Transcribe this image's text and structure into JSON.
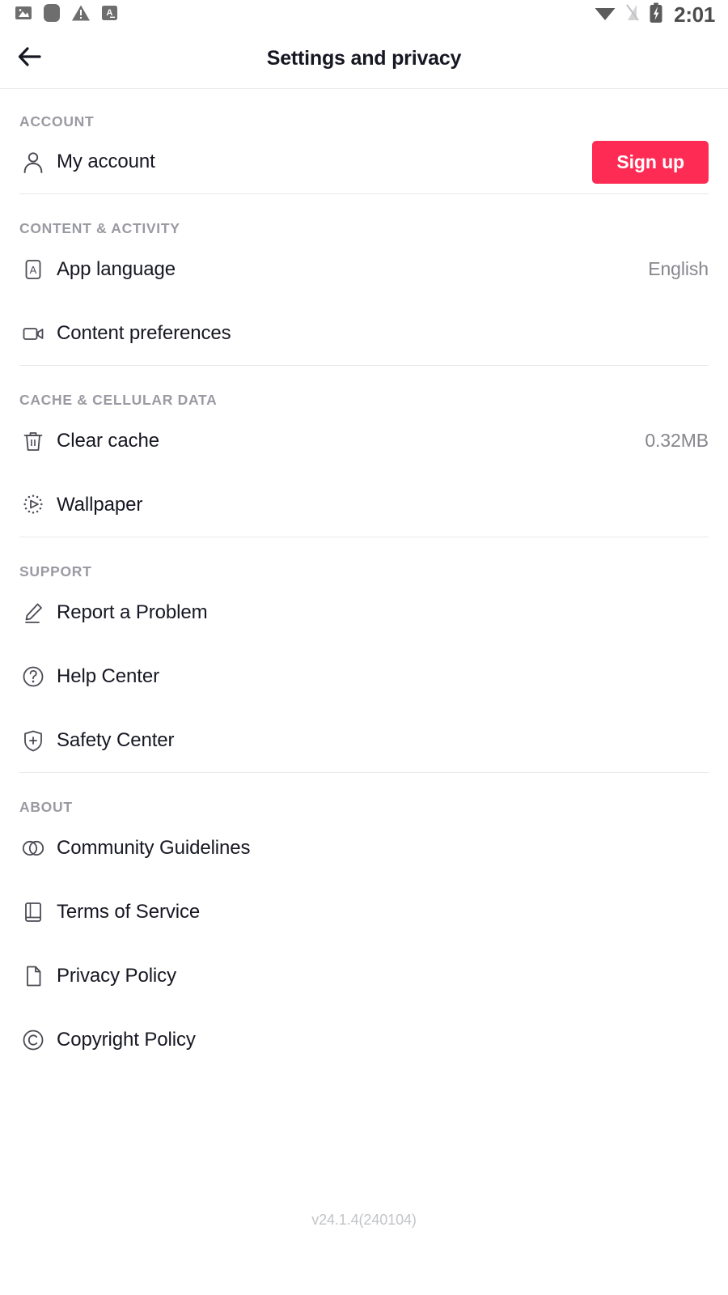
{
  "statusbar": {
    "left_icons": [
      "photo-icon",
      "rounded-square-icon",
      "warning-triangle-icon",
      "keyboard-language-icon"
    ],
    "right_icons": [
      "wifi-icon",
      "signal-off-icon",
      "battery-charging-icon"
    ],
    "time": "2:01"
  },
  "header": {
    "back_icon": "arrow-left-icon",
    "title": "Settings and privacy"
  },
  "colors": {
    "accent": "#fe2c55",
    "text_primary": "#161722",
    "text_secondary": "#86868d",
    "section_header": "#9a9aa2",
    "divider": "#e8e9eb",
    "version_text": "#c3c4c8"
  },
  "sections": [
    {
      "key": "account",
      "title": "ACCOUNT",
      "rows": [
        {
          "icon": "person-icon",
          "label": "My account",
          "value": "",
          "button": "Sign up"
        }
      ]
    },
    {
      "key": "content_activity",
      "title": "CONTENT & ACTIVITY",
      "rows": [
        {
          "icon": "language-a-icon",
          "label": "App language",
          "value": "English",
          "button": ""
        },
        {
          "icon": "video-camera-icon",
          "label": "Content preferences",
          "value": "",
          "button": ""
        }
      ]
    },
    {
      "key": "cache_cellular",
      "title": "CACHE & CELLULAR DATA",
      "rows": [
        {
          "icon": "trash-icon",
          "label": "Clear cache",
          "value": "0.32MB",
          "button": ""
        },
        {
          "icon": "wallpaper-play-icon",
          "label": "Wallpaper",
          "value": "",
          "button": ""
        }
      ]
    },
    {
      "key": "support",
      "title": "SUPPORT",
      "rows": [
        {
          "icon": "pencil-icon",
          "label": "Report a Problem",
          "value": "",
          "button": ""
        },
        {
          "icon": "question-circle-icon",
          "label": "Help Center",
          "value": "",
          "button": ""
        },
        {
          "icon": "shield-plus-icon",
          "label": "Safety Center",
          "value": "",
          "button": ""
        }
      ]
    },
    {
      "key": "about",
      "title": "ABOUT",
      "rows": [
        {
          "icon": "two-circles-icon",
          "label": "Community Guidelines",
          "value": "",
          "button": ""
        },
        {
          "icon": "book-icon",
          "label": "Terms of Service",
          "value": "",
          "button": ""
        },
        {
          "icon": "document-icon",
          "label": "Privacy Policy",
          "value": "",
          "button": ""
        },
        {
          "icon": "copyright-icon",
          "label": "Copyright Policy",
          "value": "",
          "button": ""
        }
      ]
    }
  ],
  "footer": {
    "version": "v24.1.4(240104)"
  }
}
